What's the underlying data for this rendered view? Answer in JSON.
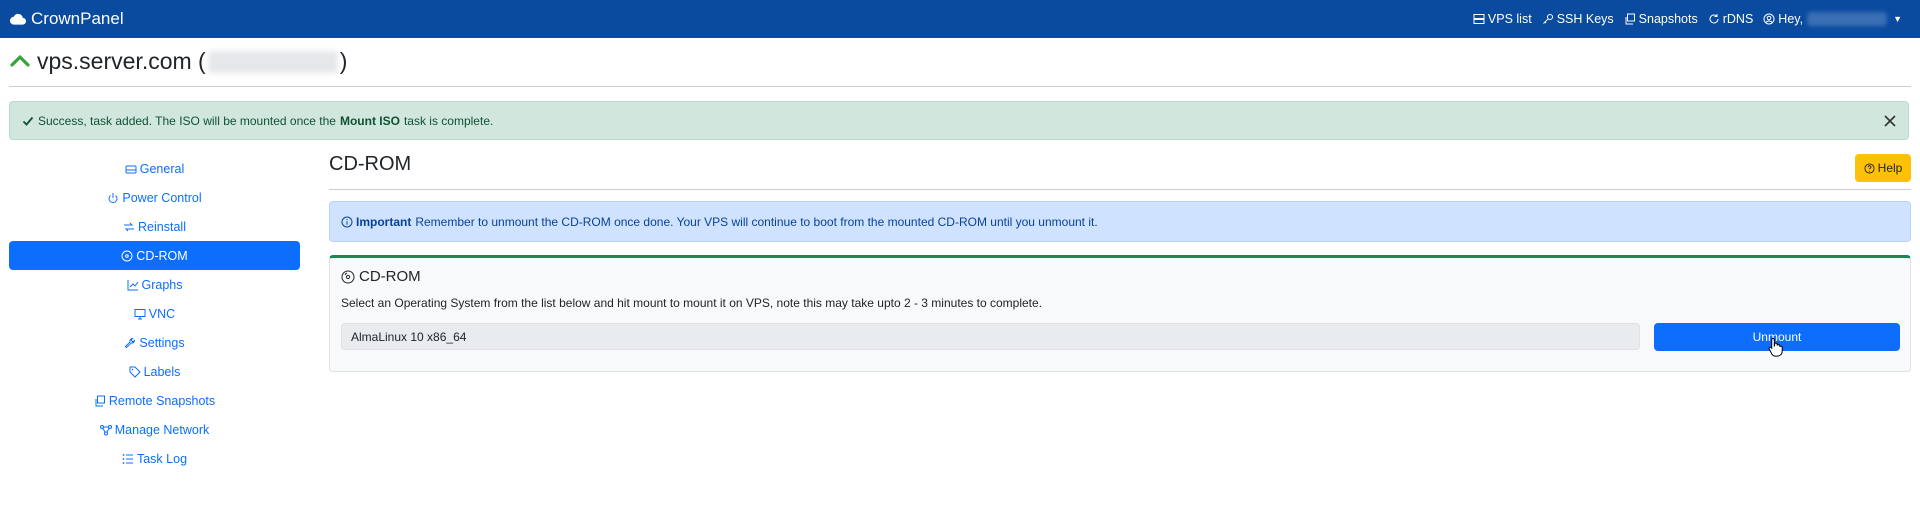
{
  "brand": {
    "name": "CrownPanel"
  },
  "nav": {
    "vps_list": "VPS list",
    "ssh_keys": "SSH Keys",
    "snapshots": "Snapshots",
    "rdns": "rDNS",
    "greeting": "Hey,"
  },
  "header": {
    "hostname": "vps.server.com (",
    "close_paren": ")"
  },
  "alert_success": {
    "prefix": "Success, task added. The ISO will be mounted once the",
    "bold": "Mount ISO",
    "suffix": "task is complete."
  },
  "sidebar": {
    "items": [
      {
        "label": "General",
        "icon": "disk-icon"
      },
      {
        "label": "Power Control",
        "icon": "power-icon"
      },
      {
        "label": "Reinstall",
        "icon": "reinstall-icon"
      },
      {
        "label": "CD-ROM",
        "icon": "disc-icon",
        "active": true
      },
      {
        "label": "Graphs",
        "icon": "graph-icon"
      },
      {
        "label": "VNC",
        "icon": "monitor-icon"
      },
      {
        "label": "Settings",
        "icon": "wrench-icon"
      },
      {
        "label": "Labels",
        "icon": "tag-icon"
      },
      {
        "label": "Remote Snapshots",
        "icon": "copy-icon"
      },
      {
        "label": "Manage Network",
        "icon": "network-icon"
      },
      {
        "label": "Task Log",
        "icon": "list-icon"
      }
    ]
  },
  "main": {
    "title": "CD-ROM",
    "help_label": "Help",
    "info_bold": "Important",
    "info_text": "Remember to unmount the CD-ROM once done. Your VPS will continue to boot from the mounted CD-ROM until you unmount it.",
    "card_title": "CD-ROM",
    "card_desc": "Select an Operating System from the list below and hit mount to mount it on VPS, note this may take upto 2 - 3 minutes to complete.",
    "selected_os": "AlmaLinux 10 x86_64",
    "unmount_label": "Unmount"
  },
  "colors": {
    "navbar": "#0a4a9f",
    "primary": "#0d6efd",
    "success_bg": "#d1e7dd",
    "info_bg": "#cfe2ff",
    "warning": "#ffc107",
    "card_accent": "#198754"
  }
}
